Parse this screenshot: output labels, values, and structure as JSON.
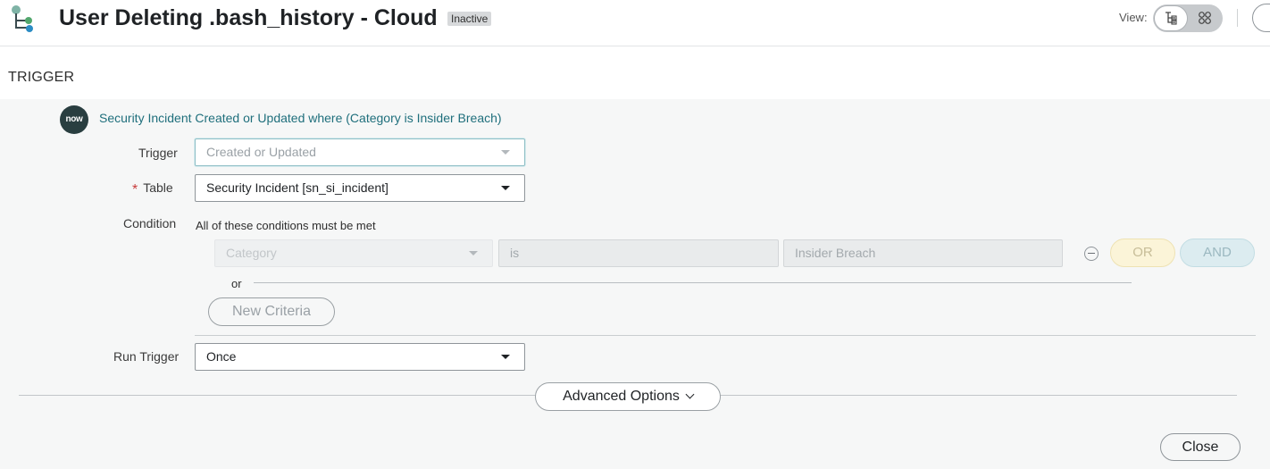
{
  "header": {
    "app_icon": "flow-designer-tree-icon",
    "title": "User Deleting .bash_history - Cloud",
    "status_badge": "Inactive",
    "view_label": "View:",
    "view_toggle": {
      "options": [
        "diagram-tree-icon",
        "grid-view-icon"
      ],
      "selected": "diagram-tree-icon"
    }
  },
  "section": {
    "title": "TRIGGER"
  },
  "trigger": {
    "logo_text": "now",
    "summary": "Security Incident Created or Updated where (Category is Insider Breach)",
    "trigger_label": "Trigger",
    "trigger_value": "Created or Updated",
    "table_required_mark": "*",
    "table_label": "Table",
    "table_value": "Security Incident [sn_si_incident]",
    "condition_label": "Condition",
    "condition_heading": "All of these conditions must be met",
    "condition": {
      "field": "Category",
      "operator": "is",
      "value": "Insider Breach",
      "or_button": "OR",
      "and_button": "AND"
    },
    "or_separator": "or",
    "new_criteria_label": "New Criteria",
    "run_trigger_label": "Run Trigger",
    "run_trigger_value": "Once",
    "advanced_options_label": "Advanced Options"
  },
  "footer": {
    "close_label": "Close"
  },
  "colors": {
    "link": "#1f6f7c",
    "panel_bg": "#f6f7f7",
    "now_logo_bg": "#293e40",
    "required": "#c83c3c",
    "or_pill": "#fbf4d8",
    "and_pill": "#dcecf0"
  }
}
